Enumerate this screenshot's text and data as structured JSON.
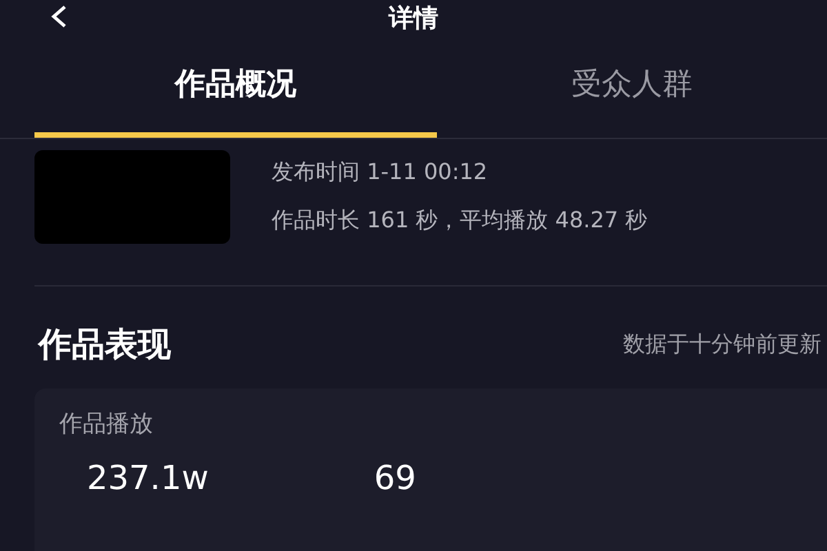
{
  "header": {
    "title": "详情"
  },
  "tabs": [
    {
      "label": "作品概况",
      "selected": true
    },
    {
      "label": "受众人群",
      "selected": false
    }
  ],
  "work": {
    "publish_time": "发布时间 1-11 00:12",
    "duration_line": "作品时长 161 秒，平均播放 48.27 秒"
  },
  "performance": {
    "title": "作品表现",
    "update_note": "数据于十分钟前更新",
    "card": {
      "label": "作品播放",
      "values": [
        "237.1w",
        "69"
      ]
    }
  }
}
